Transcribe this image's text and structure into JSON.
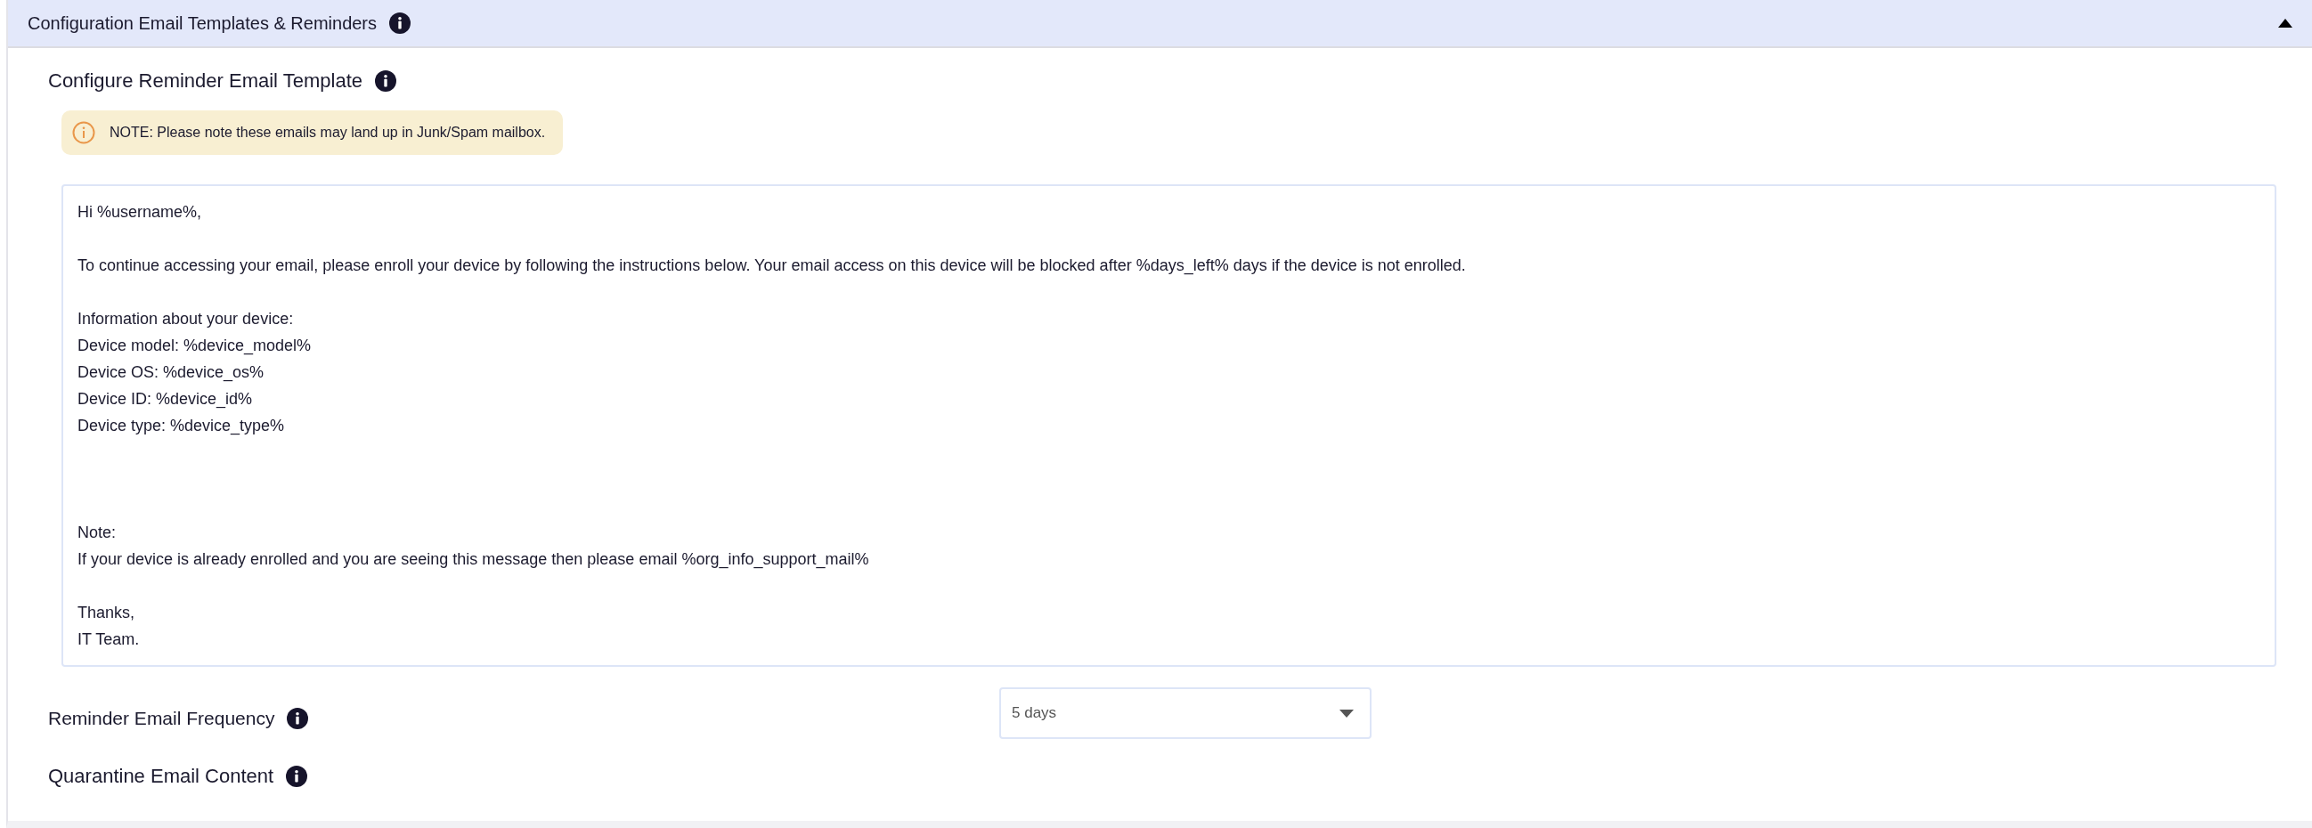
{
  "section": {
    "title": "Configuration Email Templates & Reminders",
    "expanded": true
  },
  "reminder_template": {
    "title": "Configure Reminder Email Template",
    "note": "NOTE: Please note these emails may land up in Junk/Spam mailbox.",
    "body": "Hi %username%,\n\nTo continue accessing your email, please enroll your device by following the instructions below. Your email access on this device will be blocked after %days_left% days if the device is not enrolled.\n\nInformation about your device:\nDevice model: %device_model%\nDevice OS: %device_os%\nDevice ID: %device_id%\nDevice type: %device_type%\n\n\n\nNote:\nIf your device is already enrolled and you are seeing this message then please email %org_info_support_mail%\n\nThanks,\nIT Team."
  },
  "reminder_frequency": {
    "label": "Reminder Email Frequency",
    "value": "5 days"
  },
  "quarantine": {
    "title": "Quarantine Email Content"
  }
}
